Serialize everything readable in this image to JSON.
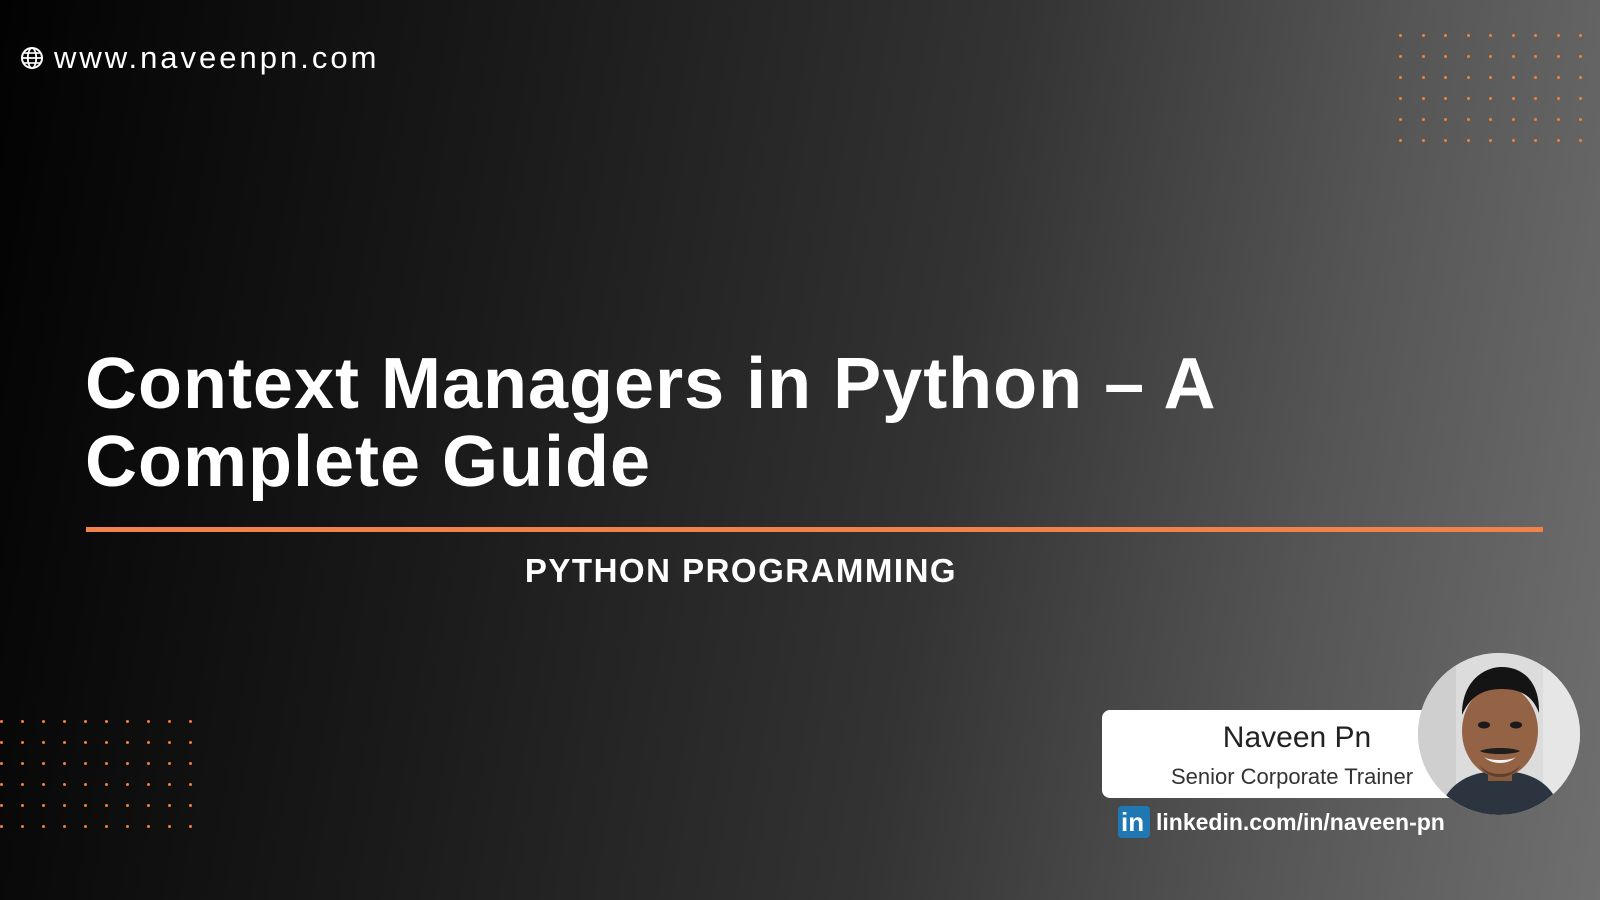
{
  "header": {
    "website": "www.naveenpn.com",
    "icon": "globe-icon"
  },
  "main": {
    "title": "Context Managers in Python – A Complete Guide",
    "subtitle": "PYTHON PROGRAMMING"
  },
  "author": {
    "name": "Naveen Pn",
    "role": "Senior Corporate Trainer",
    "linkedin_icon_text": "in",
    "linkedin_url": "linkedin.com/in/naveen-pn"
  },
  "colors": {
    "accent": "#f0824a",
    "linkedin": "#1f78b4",
    "text": "#ffffff"
  }
}
